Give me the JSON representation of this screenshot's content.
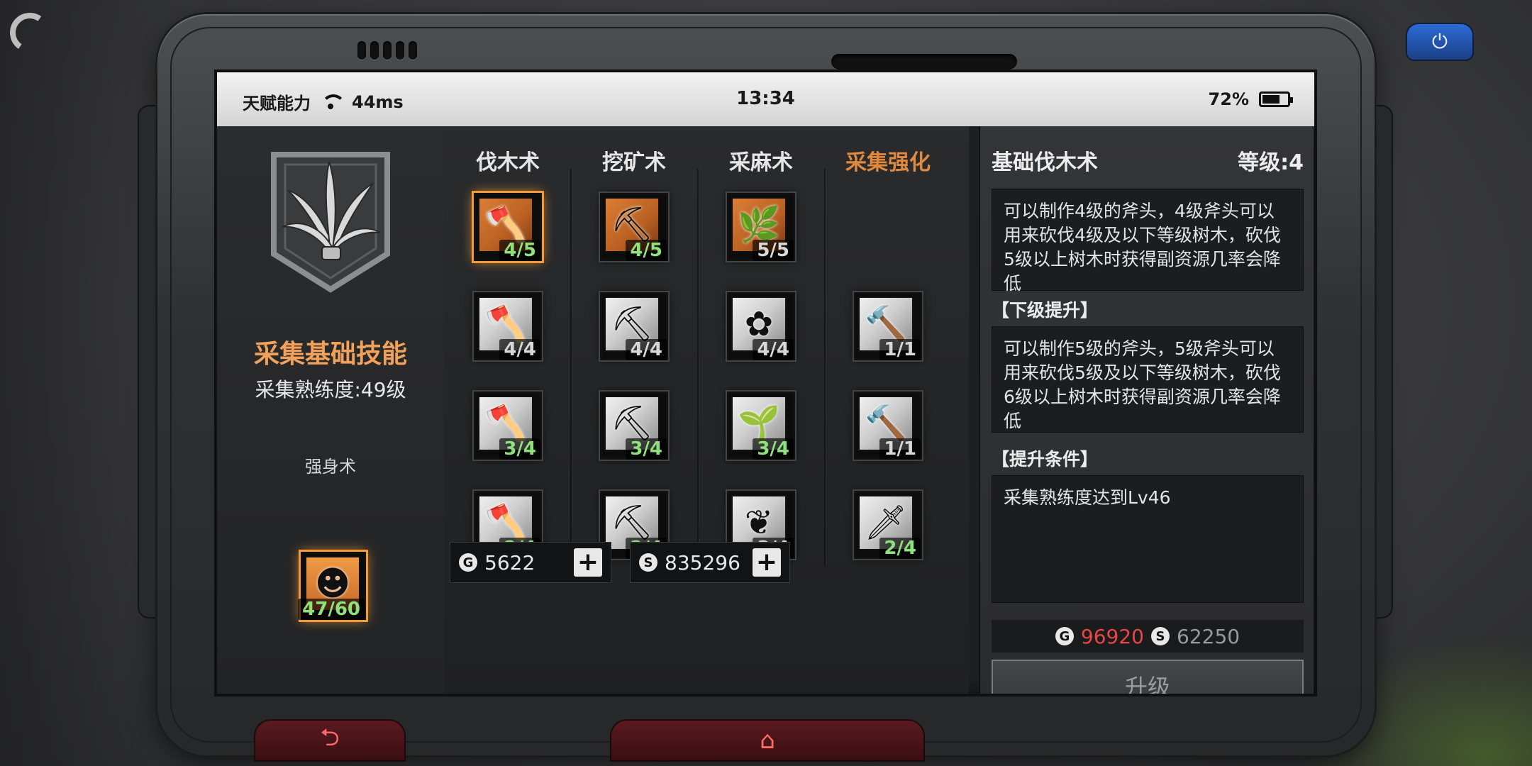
{
  "status_bar": {
    "app_name": "天赋能力",
    "ping": "44ms",
    "time": "13:34",
    "battery": "72%",
    "battery_level": 0.72
  },
  "left_panel": {
    "skill_title": "采集基础技能",
    "skill_level": "采集熟练度:49级",
    "strength_label": "强身术",
    "strength_count": "47/60"
  },
  "columns": [
    {
      "label": "伐木术",
      "active": false
    },
    {
      "label": "挖矿术",
      "active": false
    },
    {
      "label": "采麻术",
      "active": false
    },
    {
      "label": "采集强化",
      "active": true
    }
  ],
  "nodes": [
    {
      "name": "felling-node-1",
      "count": "4/5",
      "count_color": "green",
      "icon": "axe-icon",
      "glyph": "🪓",
      "orange": true,
      "glow": true
    },
    {
      "name": "mining-node-1",
      "count": "4/5",
      "count_color": "green",
      "icon": "pickaxe-icon",
      "glyph": "⛏",
      "orange": true,
      "glow": false
    },
    {
      "name": "hemp-node-1",
      "count": "5/5",
      "count_color": "white",
      "icon": "plant-icon",
      "glyph": "🌿",
      "orange": true,
      "glow": false
    },
    {
      "name": "felling-node-2",
      "count": "4/4",
      "count_color": "white",
      "icon": "axe-icon",
      "glyph": "🪓",
      "orange": false,
      "glow": false
    },
    {
      "name": "mining-node-2",
      "count": "4/4",
      "count_color": "white",
      "icon": "pickaxe-icon",
      "glyph": "⛏",
      "orange": false,
      "glow": false
    },
    {
      "name": "hemp-node-2",
      "count": "4/4",
      "count_color": "white",
      "icon": "flower-icon",
      "glyph": "✿",
      "orange": false,
      "glow": false
    },
    {
      "name": "boost-node-1",
      "count": "1/1",
      "count_color": "white",
      "icon": "hammer-icon",
      "glyph": "🔨",
      "orange": false,
      "glow": false
    },
    {
      "name": "felling-node-3",
      "count": "3/4",
      "count_color": "green",
      "icon": "axe-icon",
      "glyph": "🪓",
      "orange": false,
      "glow": false
    },
    {
      "name": "mining-node-3",
      "count": "3/4",
      "count_color": "green",
      "icon": "pickaxe-icon",
      "glyph": "⛏",
      "orange": false,
      "glow": false
    },
    {
      "name": "hemp-node-3",
      "count": "3/4",
      "count_color": "green",
      "icon": "sprout-icon",
      "glyph": "🌱",
      "orange": false,
      "glow": false
    },
    {
      "name": "boost-node-2",
      "count": "1/1",
      "count_color": "white",
      "icon": "hammer-icon",
      "glyph": "🔨",
      "orange": false,
      "glow": false
    },
    {
      "name": "felling-node-4",
      "count": "2/4",
      "count_color": "green",
      "icon": "axe-icon",
      "glyph": "🪓",
      "orange": false,
      "glow": false
    },
    {
      "name": "mining-node-4",
      "count": "2/4",
      "count_color": "green",
      "icon": "pickaxe-icon",
      "glyph": "⛏",
      "orange": false,
      "glow": false
    },
    {
      "name": "hemp-node-4",
      "count": "3/4",
      "count_color": "white",
      "icon": "leaf-icon",
      "glyph": "❦",
      "orange": false,
      "glow": false
    },
    {
      "name": "boost-node-3",
      "count": "2/4",
      "count_color": "green",
      "icon": "knife-icon",
      "glyph": "🗡",
      "orange": false,
      "glow": false
    }
  ],
  "currency": {
    "gold_icon": "G",
    "gold": "5622",
    "silver_icon": "S",
    "silver": "835296",
    "plus": "+"
  },
  "detail": {
    "title": "基础伐木术",
    "level": "等级:4",
    "description": "可以制作4级的斧头，4级斧头可以用来砍伐4级及以下等级树木，砍伐5级以上树木时获得副资源几率会降低",
    "next_level_header": "【下级提升】",
    "next_level_desc": "可以制作5级的斧头，5级斧头可以用来砍伐5级及以下等级树木，砍伐6级以上树木时获得副资源几率会降低",
    "requirement_header": "【提升条件】",
    "requirement": "采集熟练度达到Lv46",
    "cost_gold": "96920",
    "cost_silver": "62250",
    "upgrade_button": "升级"
  },
  "nav": {
    "power_icon": "⏻",
    "back_icon": "⮌",
    "home_icon": "⌂"
  },
  "colors": {
    "accent_orange": "#e0893f",
    "progress_green": "#8fe27b",
    "cost_red": "#e84747",
    "power_blue": "#2d6bd6"
  }
}
